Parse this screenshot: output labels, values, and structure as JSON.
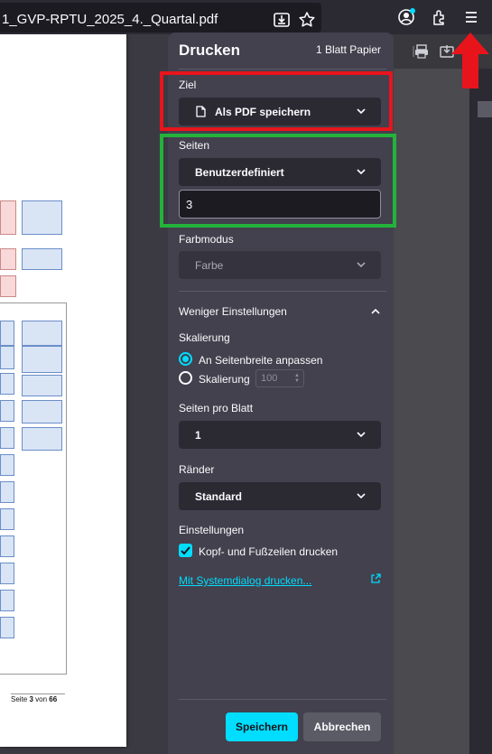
{
  "browser": {
    "tab_title": "1_GVP-RPTU_2025_4._Quartal.pdf"
  },
  "document": {
    "page_label": "Seite",
    "page_current": "3",
    "page_of": "von",
    "page_total": "66"
  },
  "print": {
    "title": "Drucken",
    "sheets": "1 Blatt Papier",
    "destination": {
      "label": "Ziel",
      "value": "Als PDF speichern"
    },
    "pages": {
      "label": "Seiten",
      "value": "Benutzerdefiniert",
      "input_value": "3"
    },
    "color": {
      "label": "Farbmodus",
      "value": "Farbe"
    },
    "less_settings": "Weniger Einstellungen",
    "scaling": {
      "label": "Skalierung",
      "option_fit": "An Seitenbreite anpassen",
      "option_scale": "Skalierung",
      "scale_value": "100",
      "selected": "fit"
    },
    "pages_per_sheet": {
      "label": "Seiten pro Blatt",
      "value": "1"
    },
    "margins": {
      "label": "Ränder",
      "value": "Standard"
    },
    "settings": {
      "label": "Einstellungen",
      "headers_footers": "Kopf- und Fußzeilen drucken",
      "headers_footers_checked": true
    },
    "system_dialog_link": "Mit Systemdialog drucken...",
    "save_button": "Speichern",
    "cancel_button": "Abbrechen"
  },
  "colors": {
    "accent": "#00ddff",
    "highlight_red": "#e8141c",
    "highlight_green": "#23b33b"
  }
}
